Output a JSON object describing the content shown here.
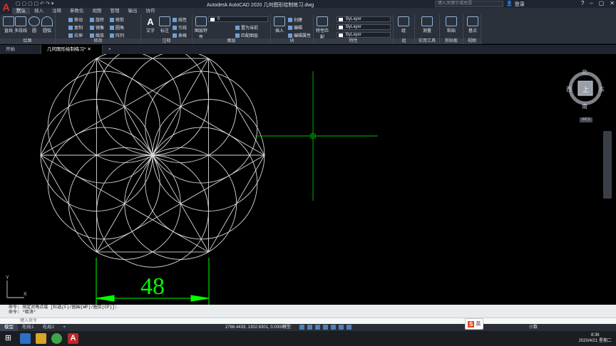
{
  "app": {
    "title": "Autodesk AutoCAD 2020   几何图形绘制练习.dwg",
    "logo": "A"
  },
  "search_placeholder": "键入关键字或短语",
  "login": "登录",
  "ribbon_tabs": [
    "默认",
    "插入",
    "注释",
    "参数化",
    "视图",
    "管理",
    "输出",
    "协作"
  ],
  "panels": {
    "draw": {
      "label": "绘图",
      "buttons": [
        "直线",
        "多段线",
        "圆",
        "圆弧"
      ]
    },
    "modify": {
      "label": "修改",
      "rows": [
        "移动",
        "旋转",
        "修剪",
        "复制",
        "镜像",
        "圆角",
        "拉伸",
        "缩放",
        "阵列"
      ]
    },
    "annotation": {
      "label": "注释",
      "buttons": [
        "文字",
        "标注"
      ],
      "rows": [
        "线性",
        "引线",
        "表格"
      ]
    },
    "layers": {
      "label": "图层",
      "buttons": [
        "图层特性"
      ],
      "current_layer": "0",
      "rows": [
        "置为当前",
        "匹配图层"
      ]
    },
    "block": {
      "label": "块",
      "buttons": [
        "插入"
      ],
      "rows": [
        "创建",
        "编辑",
        "编辑属性"
      ]
    },
    "properties": {
      "label": "特性",
      "buttons": [
        "特性匹配"
      ],
      "bylayer": [
        "ByLayer",
        "ByLayer",
        "ByLayer"
      ]
    },
    "groups": {
      "label": "组",
      "buttons": [
        "组"
      ]
    },
    "utilities": {
      "label": "实用工具",
      "buttons": [
        "测量"
      ]
    },
    "clipboard": {
      "label": "剪贴板",
      "buttons": [
        "粘贴"
      ]
    },
    "view": {
      "label": "视图",
      "buttons": [
        "基点"
      ]
    }
  },
  "doc_tabs": [
    "开始",
    "几何图形绘制练习*"
  ],
  "viewcube": {
    "north": "北",
    "south": "南",
    "east": "东",
    "west": "西",
    "top": "上",
    "wcs": "WCS"
  },
  "dimension": "48",
  "ucs": {
    "x": "X",
    "y": "Y"
  },
  "command_history": [
    "命令: 指定对角点或 [栏选(F)/圈围(WP)/圈交(CP)]:",
    "命令: *取消*"
  ],
  "command_placeholder": "键入命令",
  "layout_tabs": [
    "模型",
    "布局1",
    "布局2"
  ],
  "status": {
    "coords": "2786.4433, 1302.6301, 0.0000",
    "mode": "模型",
    "scale": "小数"
  },
  "ime": {
    "logo": "S",
    "lang": "英"
  },
  "clock": {
    "time": "8:36",
    "date": "2020/4/21 星期二"
  },
  "colors": {
    "accent": "#00ff00",
    "drawing": "#ffffff",
    "ribbon": "#2b313b",
    "crosshair": "#00c000"
  }
}
